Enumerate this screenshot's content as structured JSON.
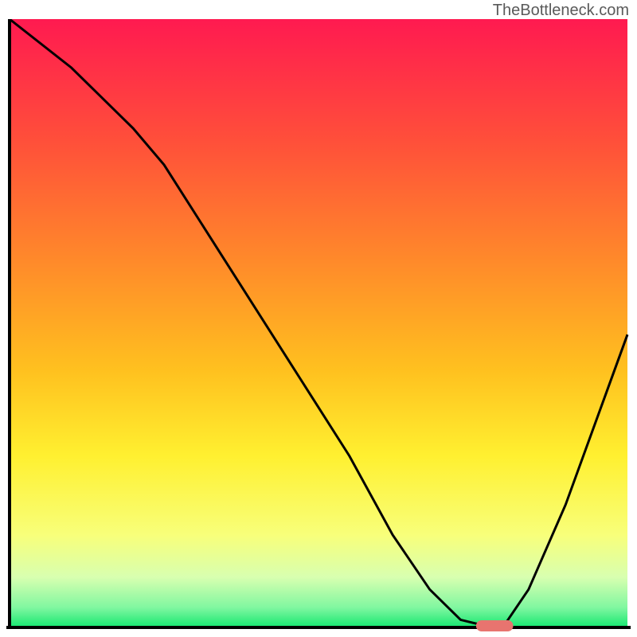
{
  "watermark": "TheBottleneck.com",
  "chart_data": {
    "type": "line",
    "title": "",
    "xlabel": "",
    "ylabel": "",
    "xlim": [
      0,
      100
    ],
    "ylim": [
      0,
      100
    ],
    "series": [
      {
        "name": "curve",
        "x": [
          0,
          10,
          20,
          25,
          35,
          45,
          55,
          62,
          68,
          73,
          77,
          80,
          84,
          90,
          95,
          100
        ],
        "y": [
          100,
          92,
          82,
          76,
          60,
          44,
          28,
          15,
          6,
          1,
          0,
          0,
          6,
          20,
          34,
          48
        ]
      }
    ],
    "marker": {
      "x_center": 78.5,
      "y": 0,
      "width": 6,
      "color": "#e8746f"
    },
    "gradient_stops": [
      {
        "offset": 0.0,
        "color": "#ff1a50"
      },
      {
        "offset": 0.2,
        "color": "#ff4f3a"
      },
      {
        "offset": 0.4,
        "color": "#ff8a2a"
      },
      {
        "offset": 0.58,
        "color": "#ffc11f"
      },
      {
        "offset": 0.72,
        "color": "#fff030"
      },
      {
        "offset": 0.85,
        "color": "#f8ff7a"
      },
      {
        "offset": 0.92,
        "color": "#d8ffb0"
      },
      {
        "offset": 0.97,
        "color": "#80f7a0"
      },
      {
        "offset": 1.0,
        "color": "#1de874"
      }
    ],
    "axis_color": "#000000"
  }
}
